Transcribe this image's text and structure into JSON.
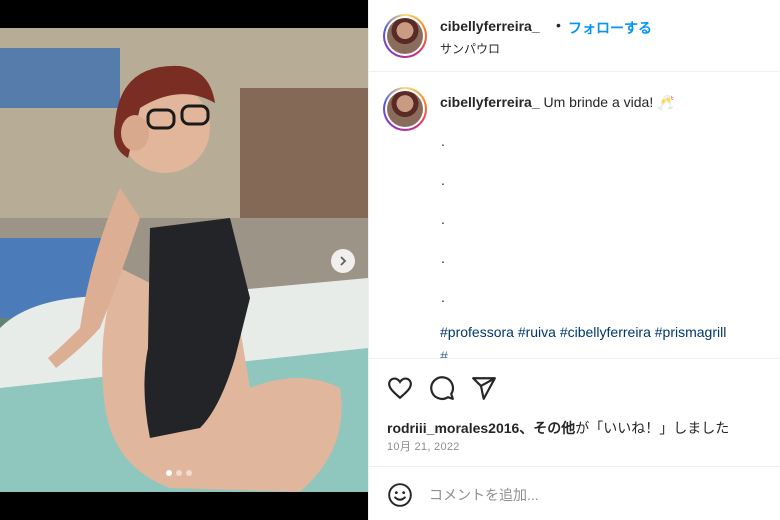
{
  "post": {
    "username": "cibellyferreira_",
    "separator": "•",
    "follow_label": "フォローする",
    "location": "サンパウロ"
  },
  "caption": {
    "username": "cibellyferreira_",
    "text": "Um brinde a vida! 🥂",
    "dots": [
      ".",
      ".",
      ".",
      ".",
      "."
    ],
    "hashtags": "#professora #ruiva #cibellyferreira #prismagrill",
    "hashtags_cut": "#..."
  },
  "actions": {
    "like_icon": "heart-icon",
    "comment_icon": "comment-icon",
    "share_icon": "share-icon"
  },
  "likes": {
    "user": "rodriii_morales2016",
    "others": "、その他",
    "suffix": "が「いいね！」しました"
  },
  "date": "10月 21, 2022",
  "comment": {
    "placeholder": "コメントを追加...",
    "emoji_icon": "smiley-icon"
  },
  "carousel": {
    "count": 3,
    "active_index": 0
  },
  "colors": {
    "link_blue": "#0095f6",
    "hashtag": "#00376b",
    "muted": "#8e8e8e"
  }
}
